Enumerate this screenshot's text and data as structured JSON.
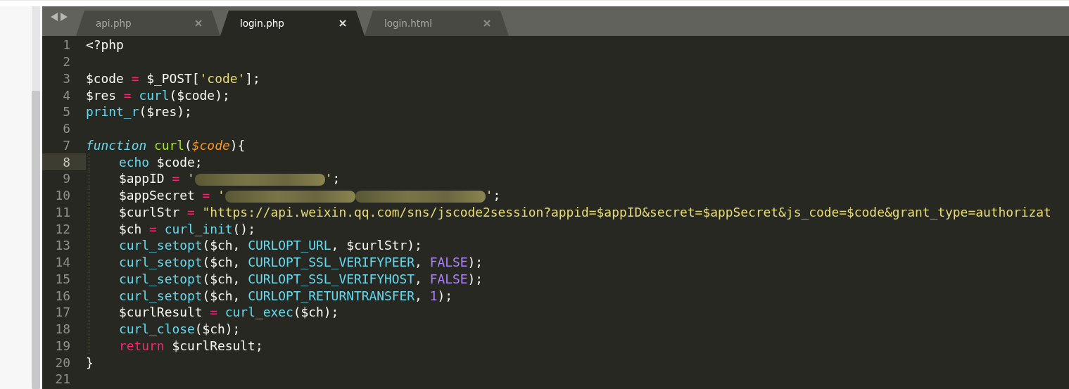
{
  "tabs": [
    {
      "label": "api.php",
      "selected": false
    },
    {
      "label": "login.php",
      "selected": true
    },
    {
      "label": "login.html",
      "selected": false
    }
  ],
  "editor": {
    "lines": [
      {
        "number": "1",
        "current": false,
        "indented": false,
        "tokens": [
          {
            "kind": "plain",
            "text": "<?php"
          }
        ]
      },
      {
        "number": "2",
        "current": false,
        "indented": false
      },
      {
        "number": "3",
        "current": false,
        "indented": false,
        "tokens": [
          {
            "kind": "plain",
            "text": "$code "
          },
          {
            "kind": "operator",
            "text": "= "
          },
          {
            "kind": "plain",
            "text": "$_POST["
          },
          {
            "kind": "string",
            "text": "'code'"
          },
          {
            "kind": "plain",
            "text": "];"
          }
        ]
      },
      {
        "number": "4",
        "current": false,
        "indented": false,
        "tokens": [
          {
            "kind": "plain",
            "text": "$res "
          },
          {
            "kind": "operator",
            "text": "= "
          },
          {
            "kind": "function",
            "text": "curl"
          },
          {
            "kind": "plain",
            "text": "($code);"
          }
        ]
      },
      {
        "number": "5",
        "current": false,
        "indented": false,
        "tokens": [
          {
            "kind": "function",
            "text": "print_r"
          },
          {
            "kind": "plain",
            "text": "($res);"
          }
        ]
      },
      {
        "number": "6",
        "current": false,
        "indented": false
      },
      {
        "number": "7",
        "current": false,
        "indented": false,
        "tokens": [
          {
            "kind": "storage",
            "text": "function "
          },
          {
            "kind": "entity",
            "text": "curl"
          },
          {
            "kind": "plain",
            "text": "("
          },
          {
            "kind": "parameter",
            "text": "$code"
          },
          {
            "kind": "plain",
            "text": "){"
          }
        ]
      },
      {
        "number": "8",
        "current": true,
        "indented": true,
        "tokens": [
          {
            "kind": "function",
            "text": "echo"
          },
          {
            "kind": "plain",
            "text": " $code;"
          }
        ]
      },
      {
        "number": "9",
        "current": false,
        "indented": true,
        "tokens": [
          {
            "kind": "plain",
            "text": "$appID "
          },
          {
            "kind": "operator",
            "text": "= "
          },
          {
            "kind": "string",
            "text": "'"
          },
          {
            "kind": "redacted"
          },
          {
            "kind": "string",
            "text": "'"
          },
          {
            "kind": "plain",
            "text": ";"
          }
        ]
      },
      {
        "number": "10",
        "current": false,
        "indented": true,
        "tokens": [
          {
            "kind": "plain",
            "text": "$appSecret "
          },
          {
            "kind": "operator",
            "text": "= "
          },
          {
            "kind": "string",
            "text": "'"
          },
          {
            "kind": "redacted"
          },
          {
            "kind": "redacted"
          },
          {
            "kind": "string",
            "text": "'"
          },
          {
            "kind": "plain",
            "text": ";"
          }
        ]
      },
      {
        "number": "11",
        "current": false,
        "indented": true,
        "tokens": [
          {
            "kind": "plain",
            "text": "$curlStr "
          },
          {
            "kind": "operator",
            "text": "= "
          },
          {
            "kind": "string",
            "text": "\"https://api.weixin.qq.com/sns/jscode2session?appid=$appID&secret=$appSecret&js_code=$code&grant_type=authorizat"
          }
        ]
      },
      {
        "number": "12",
        "current": false,
        "indented": true,
        "tokens": [
          {
            "kind": "plain",
            "text": "$ch "
          },
          {
            "kind": "operator",
            "text": "= "
          },
          {
            "kind": "function",
            "text": "curl_init"
          },
          {
            "kind": "plain",
            "text": "();"
          }
        ]
      },
      {
        "number": "13",
        "current": false,
        "indented": true,
        "tokens": [
          {
            "kind": "function",
            "text": "curl_setopt"
          },
          {
            "kind": "plain",
            "text": "($ch, "
          },
          {
            "kind": "function",
            "text": "CURLOPT_URL"
          },
          {
            "kind": "plain",
            "text": ", $curlStr);"
          }
        ]
      },
      {
        "number": "14",
        "current": false,
        "indented": true,
        "tokens": [
          {
            "kind": "function",
            "text": "curl_setopt"
          },
          {
            "kind": "plain",
            "text": "($ch, "
          },
          {
            "kind": "function",
            "text": "CURLOPT_SSL_VERIFYPEER"
          },
          {
            "kind": "plain",
            "text": ", "
          },
          {
            "kind": "constant",
            "text": "FALSE"
          },
          {
            "kind": "plain",
            "text": ");"
          }
        ]
      },
      {
        "number": "15",
        "current": false,
        "indented": true,
        "tokens": [
          {
            "kind": "function",
            "text": "curl_setopt"
          },
          {
            "kind": "plain",
            "text": "($ch, "
          },
          {
            "kind": "function",
            "text": "CURLOPT_SSL_VERIFYHOST"
          },
          {
            "kind": "plain",
            "text": ", "
          },
          {
            "kind": "constant",
            "text": "FALSE"
          },
          {
            "kind": "plain",
            "text": ");"
          }
        ]
      },
      {
        "number": "16",
        "current": false,
        "indented": true,
        "tokens": [
          {
            "kind": "function",
            "text": "curl_setopt"
          },
          {
            "kind": "plain",
            "text": "($ch, "
          },
          {
            "kind": "function",
            "text": "CURLOPT_RETURNTRANSFER"
          },
          {
            "kind": "plain",
            "text": ", "
          },
          {
            "kind": "constant",
            "text": "1"
          },
          {
            "kind": "plain",
            "text": ");"
          }
        ]
      },
      {
        "number": "17",
        "current": false,
        "indented": true,
        "tokens": [
          {
            "kind": "plain",
            "text": "$curlResult "
          },
          {
            "kind": "operator",
            "text": "= "
          },
          {
            "kind": "function",
            "text": "curl_exec"
          },
          {
            "kind": "plain",
            "text": "($ch);"
          }
        ]
      },
      {
        "number": "18",
        "current": false,
        "indented": true,
        "tokens": [
          {
            "kind": "function",
            "text": "curl_close"
          },
          {
            "kind": "plain",
            "text": "($ch);"
          }
        ]
      },
      {
        "number": "19",
        "current": false,
        "indented": true,
        "tokens": [
          {
            "kind": "keyword",
            "text": "return"
          },
          {
            "kind": "plain",
            "text": " $curlResult;"
          }
        ]
      },
      {
        "number": "20",
        "current": false,
        "indented": false,
        "tokens": [
          {
            "kind": "plain",
            "text": "}"
          }
        ]
      },
      {
        "number": "21",
        "current": false,
        "indented": false
      }
    ]
  }
}
